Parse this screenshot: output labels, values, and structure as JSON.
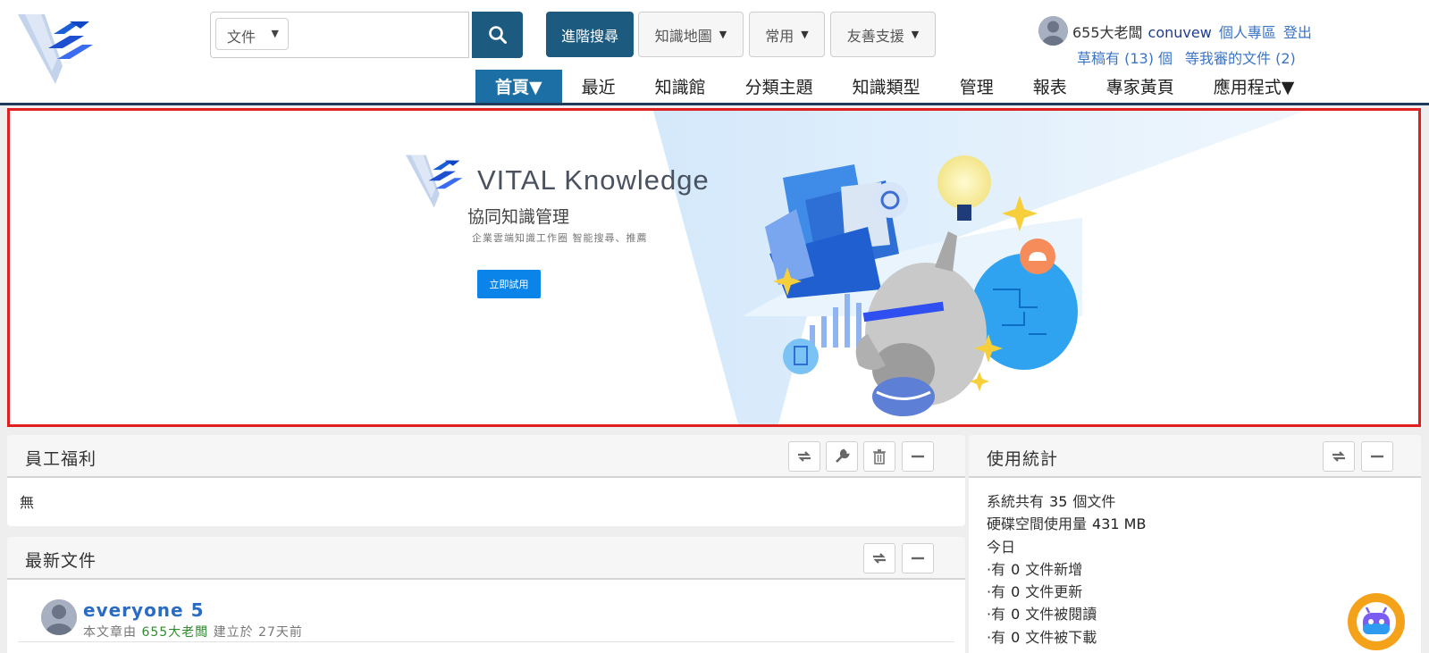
{
  "search": {
    "scope": "文件",
    "placeholder": "",
    "advanced_label": "進階搜尋",
    "dropdowns": [
      "知識地圖",
      "常用",
      "友善支援"
    ]
  },
  "user": {
    "name": "655大老闆",
    "account": "conuvew",
    "profile_link": "個人專區",
    "logout_link": "登出",
    "drafts": "草稿有 (13) 個",
    "pending": "等我審的文件 (2)"
  },
  "nav": {
    "items": [
      "首頁▼",
      "最近",
      "知識館",
      "分類主題",
      "知識類型",
      "管理",
      "報表",
      "專家黃頁",
      "應用程式▼"
    ]
  },
  "banner": {
    "brand": "VITAL Knowledge",
    "tagline": "協同知識管理",
    "subtitle": "企業雲端知識工作圈 智能搜尋、推薦",
    "cta": "立即試用"
  },
  "welfare": {
    "title": "員工福利",
    "content": "無"
  },
  "latest": {
    "title": "最新文件",
    "docs": [
      {
        "title": "everyone 5",
        "prefix": "本文章由",
        "author": "655大老闆",
        "created": "建立於",
        "age": "27天前"
      }
    ]
  },
  "stats": {
    "title": "使用統計",
    "total_prefix": "系統共有",
    "total_docs": "35",
    "total_suffix": "個文件",
    "disk_label": "硬碟空間使用量",
    "disk_value": "431 MB",
    "today": "今日",
    "line_prefix": "·有",
    "new_count": "0",
    "new_label": "文件新增",
    "upd_count": "0",
    "upd_label": "文件更新",
    "read_count": "0",
    "read_label": "文件被閱讀",
    "dl_count": "0",
    "dl_label": "文件被下載"
  },
  "colors": {
    "primary": "#1c5a80",
    "nav_active": "#1c6fa5",
    "banner_border": "#e02020",
    "link": "#3a74c7",
    "cta": "#0a84e8"
  }
}
